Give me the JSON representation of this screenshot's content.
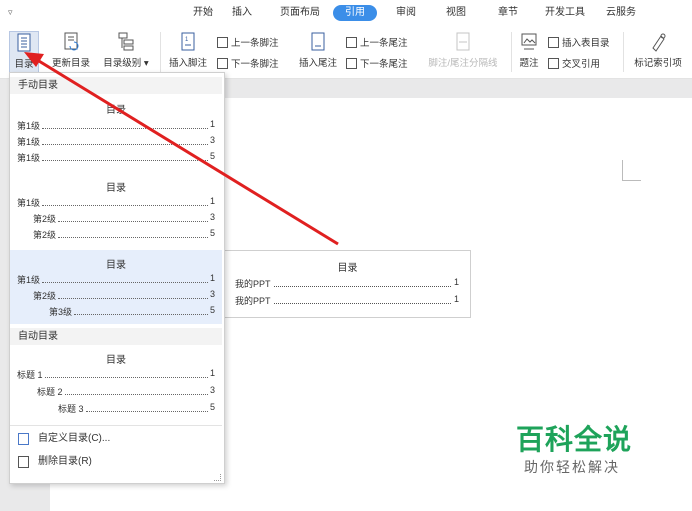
{
  "tabs": [
    {
      "label": "开始"
    },
    {
      "label": "插入"
    },
    {
      "label": "页面布局"
    },
    {
      "label": "引用"
    },
    {
      "label": "审阅"
    },
    {
      "label": "视图"
    },
    {
      "label": "章节"
    },
    {
      "label": "开发工具"
    },
    {
      "label": "云服务"
    }
  ],
  "active_tab": "引用",
  "accent_color": "#3b8ee8",
  "ribbon": {
    "toc": "目录",
    "update_toc": "更新目录",
    "toc_level": "目录级别",
    "insert_footnote": "插入脚注",
    "prev_footnote": "上一条脚注",
    "next_footnote": "下一条脚注",
    "insert_endnote": "插入尾注",
    "prev_endnote": "上一条尾注",
    "next_endnote": "下一条尾注",
    "footnote_separator": "脚注/尾注分隔线",
    "caption": "题注",
    "insert_figure_toc": "插入表目录",
    "cross_reference": "交叉引用",
    "mark_citation": "标记索引项"
  },
  "dropdown": {
    "manual_header": "手动目录",
    "auto_header": "自动目录",
    "blocks": [
      {
        "title": "目录",
        "lines": [
          {
            "text": "第1级",
            "page": "1",
            "indent": 0
          },
          {
            "text": "第1级",
            "page": "3",
            "indent": 0
          },
          {
            "text": "第1级",
            "page": "5",
            "indent": 0
          }
        ]
      },
      {
        "title": "目录",
        "lines": [
          {
            "text": "第1级",
            "page": "1",
            "indent": 0
          },
          {
            "text": "第2级",
            "page": "3",
            "indent": 1
          },
          {
            "text": "第2级",
            "page": "5",
            "indent": 1
          }
        ]
      },
      {
        "title": "目录",
        "lines": [
          {
            "text": "第1级",
            "page": "1",
            "indent": 0
          },
          {
            "text": "第2级",
            "page": "3",
            "indent": 1
          },
          {
            "text": "第3级",
            "page": "5",
            "indent": 2
          }
        ]
      },
      {
        "title": "目录",
        "lines": [
          {
            "text": "标题 1",
            "page": "1",
            "indent": 0
          },
          {
            "text": "标题 2",
            "page": "3",
            "indent": 1
          },
          {
            "text": "标题 3",
            "page": "5",
            "indent": 2
          }
        ]
      }
    ],
    "custom_toc": "自定义目录(C)...",
    "delete_toc": "删除目录(R)"
  },
  "document_toc": {
    "title": "目录",
    "lines": [
      {
        "text": "我的PPT",
        "page": "1"
      },
      {
        "text": "我的PPT",
        "page": "1"
      }
    ]
  },
  "watermark": {
    "logo": "百科全说",
    "tagline": "助你轻松解决"
  }
}
